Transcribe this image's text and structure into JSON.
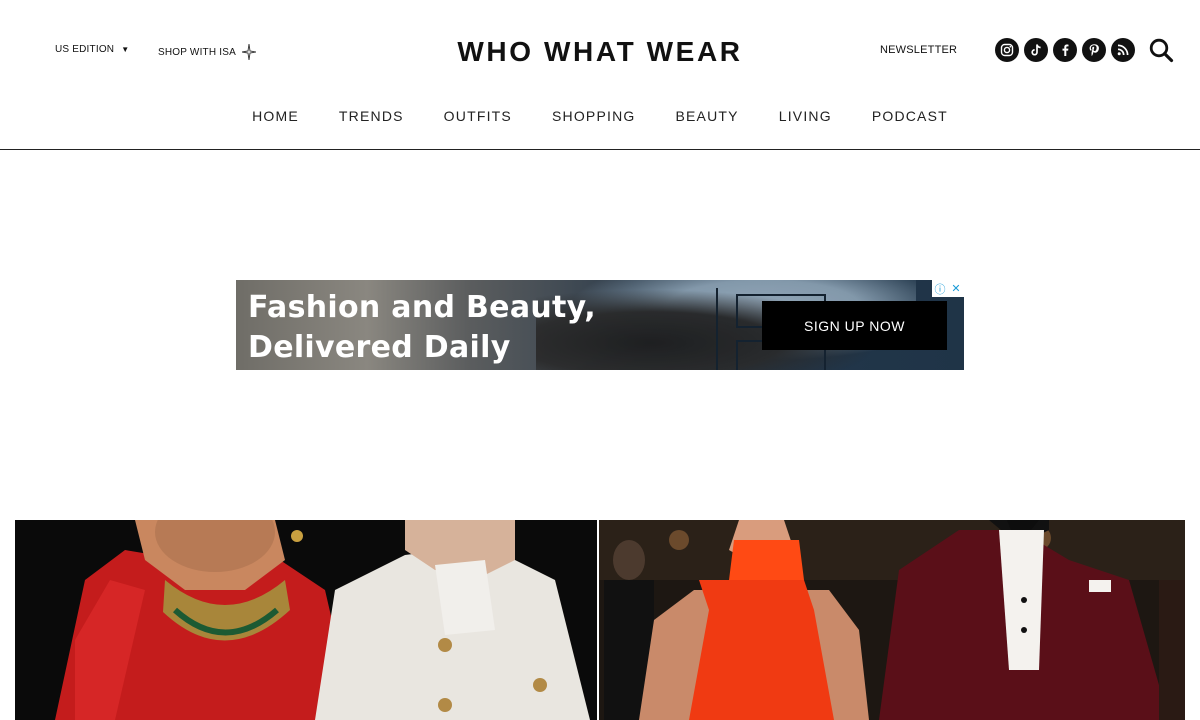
{
  "header": {
    "edition_label": "US EDITION",
    "shop_label": "SHOP WITH ISA",
    "logo_text": "WHO WHAT WEAR",
    "newsletter_label": "NEWSLETTER",
    "social_icons": [
      "instagram-icon",
      "tiktok-icon",
      "facebook-icon",
      "pinterest-icon",
      "rss-icon"
    ]
  },
  "nav": {
    "items": [
      "HOME",
      "TRENDS",
      "OUTFITS",
      "SHOPPING",
      "BEAUTY",
      "LIVING",
      "PODCAST"
    ]
  },
  "ad": {
    "headline_line1": "Fashion and Beauty,",
    "headline_line2": "Delivered Daily",
    "cta_label": "SIGN UP NOW"
  },
  "colors": {
    "text": "#111111",
    "ad_cta_bg": "#000000",
    "ad_choices_blue": "#1a9bd7"
  }
}
